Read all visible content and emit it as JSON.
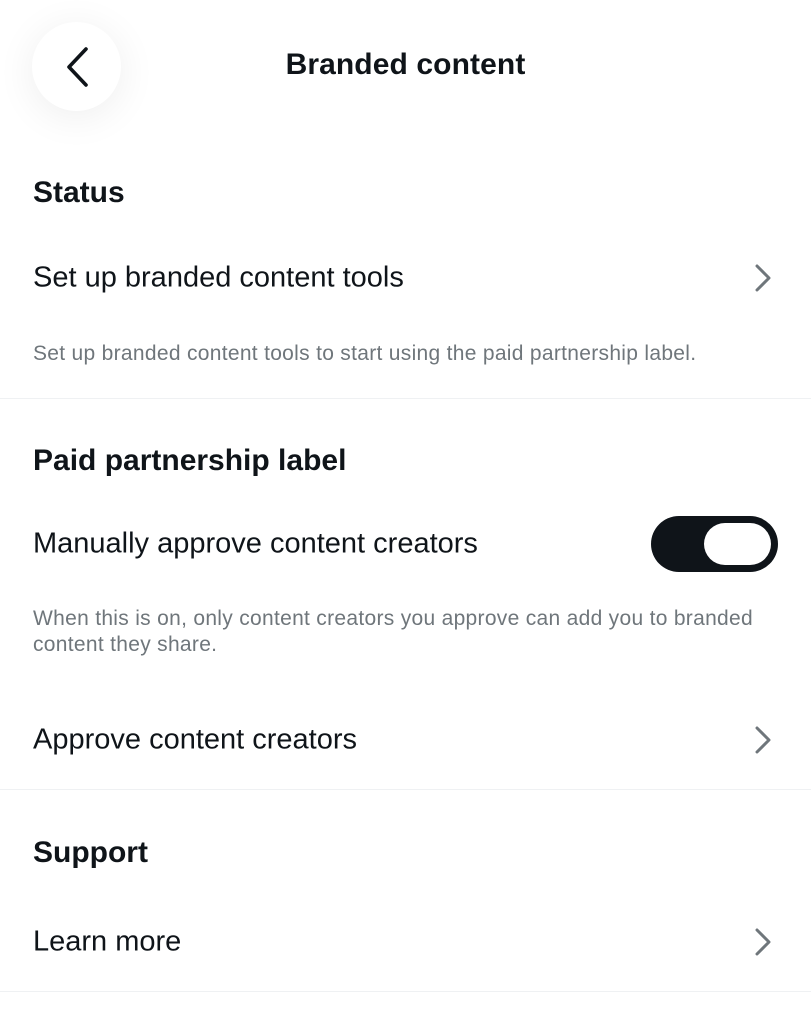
{
  "header": {
    "title": "Branded content",
    "back_icon": "chevron-left-icon"
  },
  "status": {
    "heading": "Status",
    "setup_row": {
      "label": "Set up branded content tools",
      "icon": "chevron-right-icon"
    },
    "helper": "Set up branded content tools to start using the paid partnership label."
  },
  "paid_partnership": {
    "heading": "Paid partnership label",
    "manual_approve": {
      "label": "Manually approve content creators",
      "enabled": true
    },
    "helper": "When this is on, only content creators you approve can add you to branded content they share.",
    "approve_row": {
      "label": "Approve content creators",
      "icon": "chevron-right-icon"
    }
  },
  "support": {
    "heading": "Support",
    "learn_more_row": {
      "label": "Learn more",
      "icon": "chevron-right-icon"
    }
  },
  "colors": {
    "text_primary": "#0f1419",
    "text_secondary": "#6f767b",
    "divider": "#eff1f3",
    "toggle_on": "#0f1419",
    "background": "#ffffff"
  }
}
